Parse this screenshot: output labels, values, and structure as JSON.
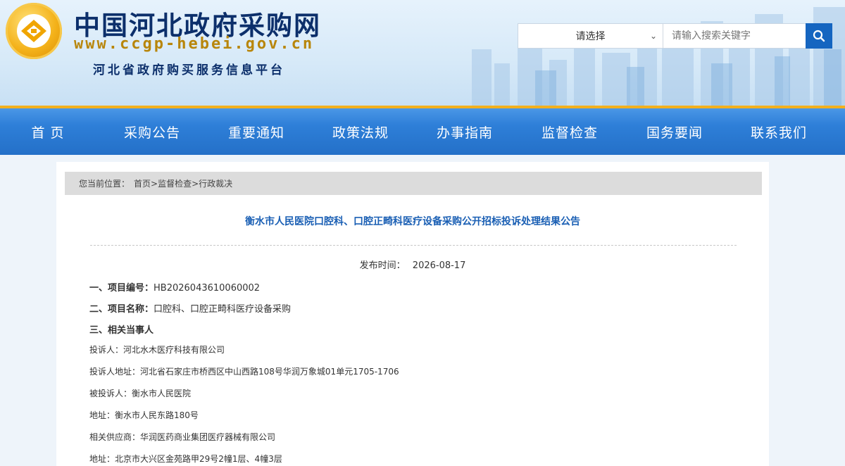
{
  "header": {
    "site_title": "中国河北政府采购网",
    "site_url": "www.ccgp-hebei.gov.cn",
    "site_subtitle": "河北省政府购买服务信息平台",
    "logo_icon": "emblem-logo-icon"
  },
  "search": {
    "select_value": "请选择",
    "placeholder": "请输入搜索关键字",
    "button_icon": "search-icon"
  },
  "nav": {
    "items": [
      "首 页",
      "采购公告",
      "重要通知",
      "政策法规",
      "办事指南",
      "监督检查",
      "国务要闻",
      "联系我们"
    ]
  },
  "breadcrumb": {
    "prefix": "您当前位置：",
    "home": "首页",
    "sep1": ">",
    "section": "监督检查",
    "sep2": ">",
    "current": "行政裁决"
  },
  "article": {
    "title": "衡水市人民医院口腔科、口腔正畸科医疗设备采购公开招标投诉处理结果公告",
    "pub_label": "发布时间：",
    "pub_date": "2026-08-17",
    "items": [
      {
        "label": "一、项目编号：",
        "value": "HB2026043610060002"
      },
      {
        "label": "二、项目名称：",
        "value": "口腔科、口腔正畸科医疗设备采购"
      },
      {
        "label": "三、相关当事人",
        "value": ""
      },
      {
        "label": "投诉人：",
        "value": "河北水木医疗科技有限公司"
      },
      {
        "label": "投诉人地址：",
        "value": "河北省石家庄市桥西区中山西路108号华润万象城01单元1705-1706"
      },
      {
        "label": "被投诉人：",
        "value": "衡水市人民医院"
      },
      {
        "label": "地址：",
        "value": "衡水市人民东路180号"
      },
      {
        "label": "相关供应商：",
        "value": "华润医药商业集团医疗器械有限公司"
      },
      {
        "label": "地址：",
        "value": "北京市大兴区金苑路甲29号2幢1层、4幢3层"
      }
    ]
  },
  "colors": {
    "nav_blue": "#2e7fd8",
    "nav_top_stripe": "#f2b01e",
    "title_blue": "#1a5fb4",
    "brand_navy": "#0c2f6b",
    "url_gold": "#b8860b"
  }
}
